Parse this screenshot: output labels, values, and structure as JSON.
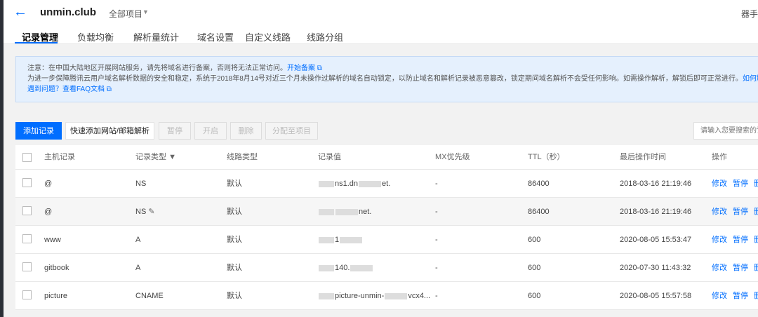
{
  "header": {
    "domain": "unmin.club",
    "project": "全部项目",
    "top_right": "器手"
  },
  "tabs": [
    {
      "label": "记录管理",
      "active": true
    },
    {
      "label": "负载均衡"
    },
    {
      "label": "解析量统计"
    },
    {
      "label": "域名设置"
    },
    {
      "label": "自定义线路"
    },
    {
      "label": "线路分组"
    }
  ],
  "notice": {
    "line1": "注意：在中国大陆地区开展网站服务，请先将域名进行备案，否则将无法正常访问。",
    "line1_link": "开始备案",
    "line2": "为进一步保障腾讯云用户域名解析数据的安全和稳定，系统于2018年8月14号对近三个月未操作过解析的域名自动锁定，以防止域名和解析记录被恶意篡改，锁定期间域名解析不会受任何影响。如需操作解析，解锁后即可正常进行。",
    "line2_link": "如何解",
    "line3_link": "遇到问题？查看FAQ文档"
  },
  "toolbar": {
    "add": "添加记录",
    "quick_add": "快速添加网站/邮箱解析",
    "pause": "暂停",
    "enable": "开启",
    "delete": "删除",
    "assign": "分配至项目",
    "search_placeholder": "请输入您要搜索的记"
  },
  "table": {
    "columns": [
      "主机记录",
      "记录类型",
      "线路类型",
      "记录值",
      "MX优先级",
      "TTL（秒）",
      "最后操作时间",
      "操作"
    ],
    "rows": [
      {
        "host": "@",
        "type": "NS",
        "line": "默认",
        "value_a": "ns1.dn",
        "value_b": "et.",
        "mx": "-",
        "ttl": "86400",
        "time": "2018-03-16 21:19:46"
      },
      {
        "host": "@",
        "type": "NS",
        "line": "默认",
        "value_a": "",
        "value_b": "net.",
        "mx": "-",
        "ttl": "86400",
        "time": "2018-03-16 21:19:46",
        "hover": true
      },
      {
        "host": "www",
        "type": "A",
        "line": "默认",
        "value_a": "1",
        "value_b": "",
        "mx": "-",
        "ttl": "600",
        "time": "2020-08-05 15:53:47"
      },
      {
        "host": "gitbook",
        "type": "A",
        "line": "默认",
        "value_a": "140.",
        "value_b": "",
        "mx": "-",
        "ttl": "600",
        "time": "2020-07-30 11:43:32"
      },
      {
        "host": "picture",
        "type": "CNAME",
        "line": "默认",
        "value_a": "picture-unmin-",
        "value_b": "vcx4...",
        "mx": "-",
        "ttl": "600",
        "time": "2020-08-05 15:57:58"
      }
    ],
    "actions": [
      "修改",
      "暂停",
      "删"
    ]
  }
}
